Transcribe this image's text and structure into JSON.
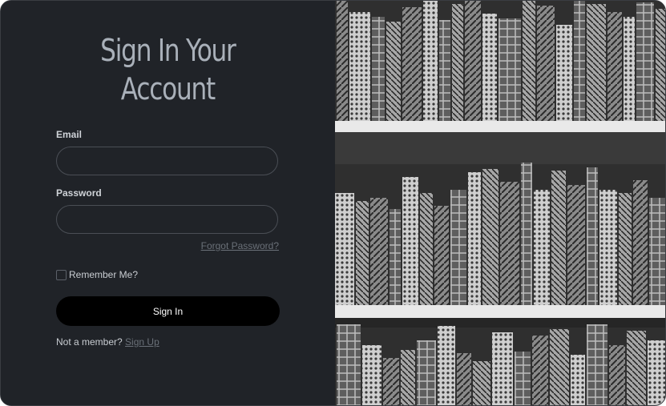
{
  "heading": {
    "line1": "Sign In Your",
    "line2": "Account"
  },
  "form": {
    "email_label": "Email",
    "email_value": "",
    "password_label": "Password",
    "password_value": "",
    "forgot_password": "Forgot Password?",
    "remember_label": "Remember Me?",
    "remember_checked": false,
    "submit_label": "Sign In",
    "not_member_text": "Not a member?",
    "signup_link": "Sign Up"
  },
  "image": {
    "description_icon": "bookshelf-photo"
  },
  "colors": {
    "panel_bg": "#202328",
    "button_bg": "#000000",
    "heading_color": "#a9b0b9",
    "link_color": "#6a7078"
  }
}
